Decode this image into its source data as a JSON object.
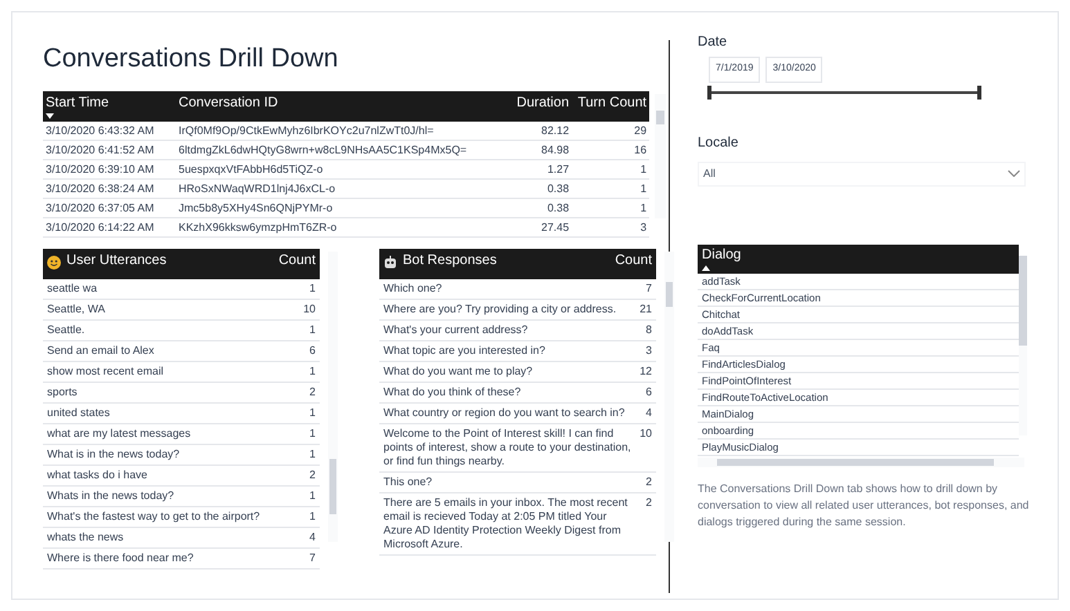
{
  "title": "Conversations Drill Down",
  "conversations": {
    "columns": [
      "Start Time",
      "Conversation ID",
      "Duration",
      "Turn Count"
    ],
    "rows": [
      {
        "start_time": "3/10/2020 6:43:32 AM",
        "conversation_id": "IrQf0Mf9Op/9CtkEwMyhz6IbrKOYc2u7nlZwTt0J/hl=",
        "duration": "82.12",
        "turn_count": "29"
      },
      {
        "start_time": "3/10/2020 6:41:52 AM",
        "conversation_id": "6ltdmgZkL6dwHQtyG8wrn+w8cL9NHsAA5C1KSp4Mx5Q=",
        "duration": "84.98",
        "turn_count": "16"
      },
      {
        "start_time": "3/10/2020 6:39:10 AM",
        "conversation_id": "5uespxqxVtFAbbH6d5TiQZ-o",
        "duration": "1.27",
        "turn_count": "1"
      },
      {
        "start_time": "3/10/2020 6:38:24 AM",
        "conversation_id": "HRoSxNWaqWRD1lnj4J6xCL-o",
        "duration": "0.38",
        "turn_count": "1"
      },
      {
        "start_time": "3/10/2020 6:37:05 AM",
        "conversation_id": "Jmc5b8y5XHy4Sn6QNjPYMr-o",
        "duration": "0.38",
        "turn_count": "1"
      },
      {
        "start_time": "3/10/2020 6:14:22 AM",
        "conversation_id": "KKzhX96kksw6ymzpHmT6ZR-o",
        "duration": "27.45",
        "turn_count": "3"
      }
    ]
  },
  "user_utterances": {
    "columns": [
      "User Utterances",
      "Count"
    ],
    "rows": [
      {
        "text": "seattle wa",
        "count": "1"
      },
      {
        "text": "Seattle, WA",
        "count": "10"
      },
      {
        "text": "Seattle.",
        "count": "1"
      },
      {
        "text": "Send an email to Alex",
        "count": "6"
      },
      {
        "text": "show most recent email",
        "count": "1"
      },
      {
        "text": "sports",
        "count": "2"
      },
      {
        "text": "united states",
        "count": "1"
      },
      {
        "text": "what are my latest messages",
        "count": "1"
      },
      {
        "text": "What is in the news today?",
        "count": "1"
      },
      {
        "text": "what tasks do i have",
        "count": "2"
      },
      {
        "text": "Whats in the news today?",
        "count": "1"
      },
      {
        "text": "What's the fastest way to get to the airport?",
        "count": "1"
      },
      {
        "text": "whats the news",
        "count": "4"
      },
      {
        "text": "Where is there food near me?",
        "count": "7"
      }
    ]
  },
  "bot_responses": {
    "columns": [
      "Bot Responses",
      "Count"
    ],
    "rows": [
      {
        "text": "Which one?",
        "count": "7"
      },
      {
        "text": "Where are you? Try providing a city or address.",
        "count": "21"
      },
      {
        "text": "What's your current address?",
        "count": "8"
      },
      {
        "text": "What topic are you interested in?",
        "count": "3"
      },
      {
        "text": "What do you want me to play?",
        "count": "12"
      },
      {
        "text": "What do you think of these?",
        "count": "6"
      },
      {
        "text": "What country or region do you want to search in?",
        "count": "4"
      },
      {
        "text": "Welcome to the Point of Interest skill! I can find points of interest, show a route to your destination, or find fun things nearby.",
        "count": "10"
      },
      {
        "text": "This one?",
        "count": "2"
      },
      {
        "text": "There are 5 emails in your inbox. The most recent email is recieved Today at 2:05 PM titled Your Azure AD Identity Protection Weekly Digest from Microsoft Azure.",
        "count": "2"
      }
    ]
  },
  "date_filter": {
    "label": "Date",
    "start": "7/1/2019",
    "end": "3/10/2020",
    "level": 1
  },
  "locale": {
    "label": "Locale",
    "value": "All"
  },
  "dialogs": {
    "column": "Dialog",
    "rows": [
      "addTask",
      "CheckForCurrentLocation",
      "Chitchat",
      "doAddTask",
      "Faq",
      "FindArticlesDialog",
      "FindPointOfInterest",
      "FindRouteToActiveLocation",
      "MainDialog",
      "onboarding",
      "PlayMusicDialog"
    ]
  },
  "description": "The Conversations Drill Down tab shows how to drill down by conversation to view all related user utterances, bot responses, and dialogs triggered during the same session."
}
